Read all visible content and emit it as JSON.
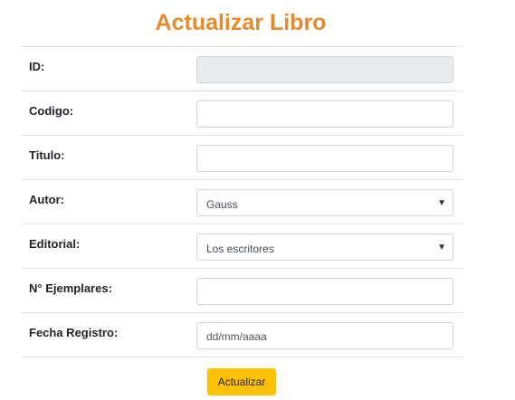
{
  "page": {
    "title": "Actualizar Libro"
  },
  "form": {
    "fields": [
      {
        "label": "ID:",
        "value": "",
        "placeholder": "",
        "disabled": true
      },
      {
        "label": "Codigo:",
        "value": "",
        "placeholder": ""
      },
      {
        "label": "Titulo:",
        "value": "",
        "placeholder": ""
      },
      {
        "label": "Autor:",
        "selected": "Gauss"
      },
      {
        "label": "Editorial:",
        "selected": "Los escritores"
      },
      {
        "label": "N° Ejemplares:",
        "value": "",
        "placeholder": ""
      },
      {
        "label": "Fecha Registro:",
        "placeholder": "dd/mm/aaaa"
      }
    ],
    "submit_label": "Actualizar"
  },
  "icons": {
    "dropdown": "caret-down-icon"
  },
  "colors": {
    "title": "#e68a2e",
    "button": "#ffc107",
    "disabled_input": "#e9ecef",
    "border": "#dee2e6"
  }
}
